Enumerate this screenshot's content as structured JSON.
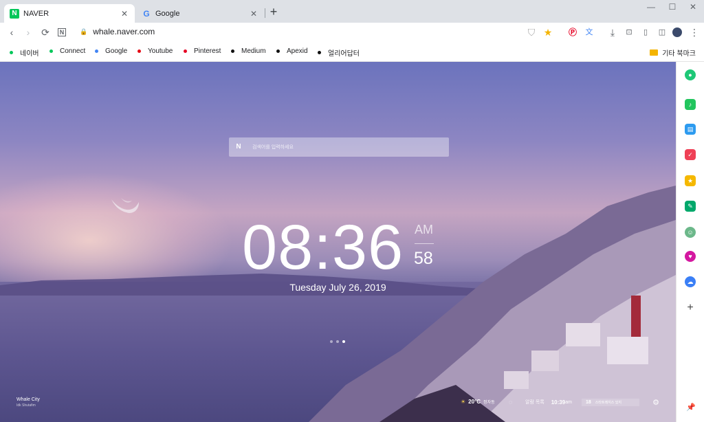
{
  "tabs": [
    {
      "title": "NAVER",
      "favicon": "naver-n-icon",
      "favicon_color": "#03c75a",
      "active": true
    },
    {
      "title": "Google",
      "favicon": "google-g-icon",
      "favicon_color": "#4285f4",
      "active": false
    }
  ],
  "toolbar": {
    "url": "whale.naver.com"
  },
  "bookmarks": [
    {
      "label": "네이버",
      "color": "#03c75a"
    },
    {
      "label": "Connect",
      "color": "#03c75a"
    },
    {
      "label": "Google",
      "color": "#4285f4"
    },
    {
      "label": "Youtube",
      "color": "#e50914"
    },
    {
      "label": "Pinterest",
      "color": "#e60023"
    },
    {
      "label": "Medium",
      "color": "#111111"
    },
    {
      "label": "Apexid",
      "color": "#111111"
    },
    {
      "label": "얼리어답터",
      "color": "#111111"
    }
  ],
  "bookmark_folder": "기타 북마크",
  "search": {
    "placeholder": "검색어를 입력하세요"
  },
  "clock": {
    "time": "08:36",
    "ampm": "AM",
    "seconds": "58",
    "date": "Tuesday July 26, 2019"
  },
  "credit": {
    "title": "Whale City",
    "author": "Idk Shutafim"
  },
  "widgets": {
    "temp": "20°C",
    "location": "정자동",
    "alarm_label": "알람 목록",
    "alarm_time": "10:39",
    "alarm_suffix": "am",
    "news_num": "18",
    "news_text": "스타트레지스 있지"
  },
  "sidebar": {
    "items": [
      {
        "name": "naver-app-icon",
        "color": "#1ec877"
      },
      {
        "name": "notification-icon",
        "color": "#22c55e"
      },
      {
        "name": "calendar-icon",
        "color": "#2d9bf0"
      },
      {
        "name": "pocket-icon",
        "color": "#ef4056"
      },
      {
        "name": "favorites-icon",
        "color": "#f5b800"
      },
      {
        "name": "translate-icon",
        "color": "#00a86b"
      },
      {
        "name": "avatar-icon",
        "color": "#6cb88a"
      },
      {
        "name": "heart-icon",
        "color": "#d418a0"
      },
      {
        "name": "cloud-icon",
        "color": "#3a7ff6"
      }
    ]
  }
}
